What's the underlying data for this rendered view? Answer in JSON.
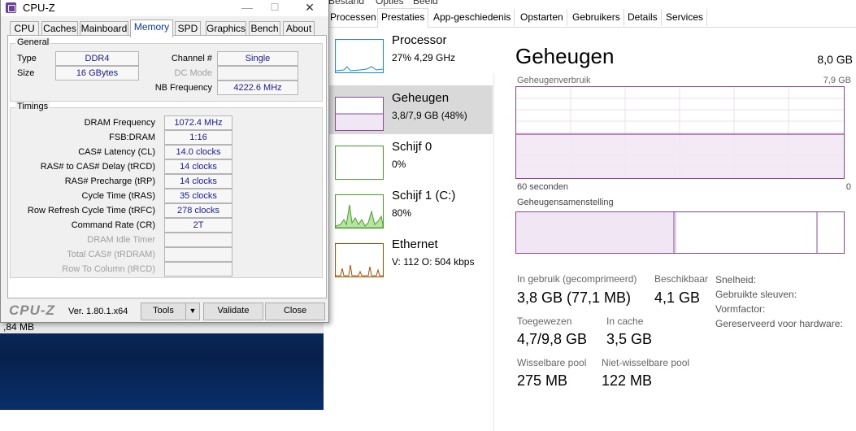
{
  "task_manager": {
    "menubar": [
      "Bestand",
      "Opties",
      "Beeld"
    ],
    "tabs": [
      "Processen",
      "Prestaties",
      "App-geschiedenis",
      "Opstarten",
      "Gebruikers",
      "Details",
      "Services"
    ],
    "active_tab": "Prestaties",
    "sidebar": [
      {
        "title": "Processor",
        "subtitle": "27% 4,29 GHz",
        "color": "#1a8ad8"
      },
      {
        "title": "Geheugen",
        "subtitle": "3,8/7,9 GB (48%)",
        "color": "#8b4a9c",
        "selected": true
      },
      {
        "title": "Schijf 0",
        "subtitle": "0%",
        "color": "#4aa02c"
      },
      {
        "title": "Schijf 1 (C:)",
        "subtitle": "80%",
        "color": "#4aa02c"
      },
      {
        "title": "Ethernet",
        "subtitle_prefix": "V:",
        "subtitle_v": "112",
        "subtitle_o_label": "O:",
        "subtitle_o": "504 kbps",
        "color": "#a74f01"
      }
    ],
    "memory": {
      "title": "Geheugen",
      "total": "8,0 GB",
      "usage_label": "Geheugenverbruik",
      "usage_max": "7,9 GB",
      "axis_left": "60 seconden",
      "axis_right": "0",
      "composition_label": "Geheugensamenstelling",
      "in_use_fraction": 0.48,
      "stats": {
        "in_use_label": "In gebruik (gecomprimeerd)",
        "in_use_value": "3,8 GB (77,1 MB)",
        "available_label": "Beschikbaar",
        "available_value": "4,1 GB",
        "committed_label": "Toegewezen",
        "committed_value": "4,7/9,8 GB",
        "cached_label": "In cache",
        "cached_value": "3,5 GB",
        "paged_label": "Wisselbare pool",
        "paged_value": "275 MB",
        "nonpaged_label": "Niet-wisselbare pool",
        "nonpaged_value": "122 MB"
      },
      "details": [
        "Snelheid:",
        "Gebruikte sleuven:",
        "Vormfactor:",
        "Gereserveerd voor hardware:"
      ]
    }
  },
  "desktop": {
    "strip_text": ",84 MB"
  },
  "cpuz": {
    "title": "CPU-Z",
    "tabs": [
      "CPU",
      "Caches",
      "Mainboard",
      "Memory",
      "SPD",
      "Graphics",
      "Bench",
      "About"
    ],
    "active_tab": "Memory",
    "general": {
      "title": "General",
      "type_label": "Type",
      "type_value": "DDR4",
      "size_label": "Size",
      "size_value": "16 GBytes",
      "channel_label": "Channel #",
      "channel_value": "Single",
      "dc_mode_label": "DC Mode",
      "dc_mode_value": "",
      "nb_freq_label": "NB Frequency",
      "nb_freq_value": "4222.6 MHz"
    },
    "timings": {
      "title": "Timings",
      "rows": [
        {
          "label": "DRAM Frequency",
          "value": "1072.4 MHz",
          "enabled": true
        },
        {
          "label": "FSB:DRAM",
          "value": "1:16",
          "enabled": true
        },
        {
          "label": "CAS# Latency (CL)",
          "value": "14.0 clocks",
          "enabled": true
        },
        {
          "label": "RAS# to CAS# Delay (tRCD)",
          "value": "14 clocks",
          "enabled": true
        },
        {
          "label": "RAS# Precharge (tRP)",
          "value": "14 clocks",
          "enabled": true
        },
        {
          "label": "Cycle Time (tRAS)",
          "value": "35 clocks",
          "enabled": true
        },
        {
          "label": "Row Refresh Cycle Time (tRFC)",
          "value": "278 clocks",
          "enabled": true
        },
        {
          "label": "Command Rate (CR)",
          "value": "2T",
          "enabled": true
        },
        {
          "label": "DRAM Idle Timer",
          "value": "",
          "enabled": false
        },
        {
          "label": "Total CAS# (tRDRAM)",
          "value": "",
          "enabled": false
        },
        {
          "label": "Row To Column (tRCD)",
          "value": "",
          "enabled": false
        }
      ]
    },
    "logo": "CPU-Z",
    "version": "Ver. 1.80.1.x64",
    "tools_label": "Tools",
    "validate_label": "Validate",
    "close_label": "Close"
  }
}
